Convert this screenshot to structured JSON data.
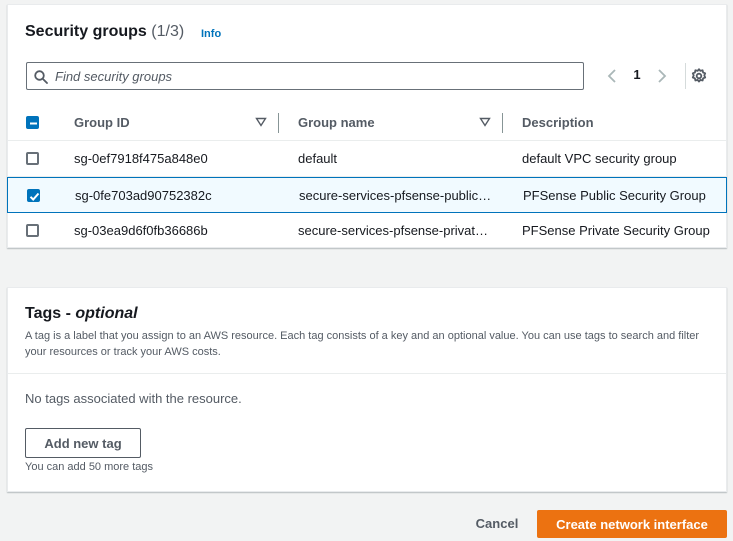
{
  "security_groups": {
    "title": "Security groups",
    "count": "(1/3)",
    "info_label": "Info",
    "search_placeholder": "Find security groups",
    "page": "1",
    "columns": {
      "group_id": "Group ID",
      "group_name": "Group name",
      "description": "Description"
    },
    "rows": [
      {
        "group_id": "sg-0ef7918f475a848e0",
        "group_name": "default",
        "description": "default VPC security group",
        "selected": false
      },
      {
        "group_id": "sg-0fe703ad90752382c",
        "group_name": "secure-services-pfsense-public…",
        "description": "PFSense Public Security Group",
        "selected": true
      },
      {
        "group_id": "sg-03ea9d6f0fb36686b",
        "group_name": "secure-services-pfsense-privat…",
        "description": "PFSense Private Security Group",
        "selected": false
      }
    ]
  },
  "tags": {
    "title": "Tags - ",
    "title_optional": "optional",
    "description": "A tag is a label that you assign to an AWS resource. Each tag consists of a key and an optional value. You can use tags to search and filter your resources or track your AWS costs.",
    "empty_text": "No tags associated with the resource.",
    "add_button": "Add new tag",
    "limit_text": "You can add 50 more tags"
  },
  "footer": {
    "cancel_label": "Cancel",
    "create_label": "Create network interface"
  },
  "colors": {
    "primary_button": "#ec7211",
    "link": "#0073bb",
    "selected_row_bg": "#f1faff"
  },
  "icons": {
    "search": "search-icon",
    "prev": "chevron-left-icon",
    "next": "chevron-right-icon",
    "settings": "gear-icon",
    "sort": "caret-down-icon"
  }
}
